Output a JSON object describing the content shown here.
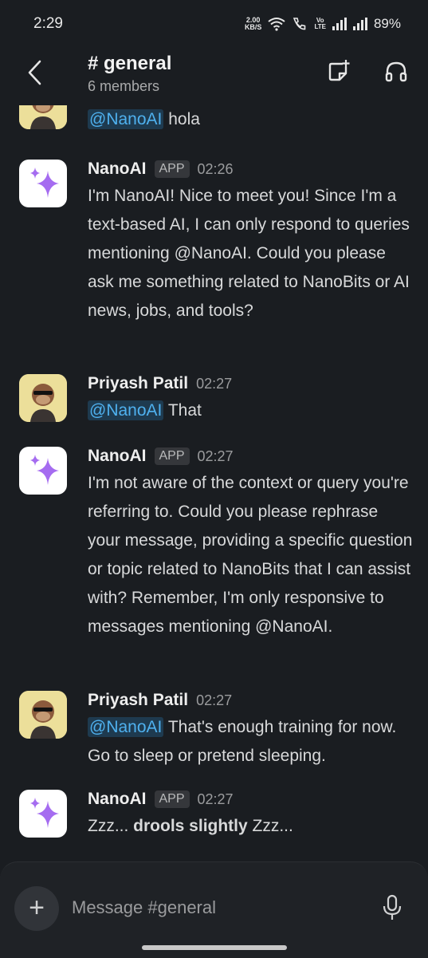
{
  "status_bar": {
    "time": "2:29",
    "net_speed_value": "2.00",
    "net_speed_unit": "KB/S",
    "volte": "Vo",
    "lte": "LTE",
    "battery": "89%"
  },
  "header": {
    "channel": "# general",
    "members": "6 members",
    "icons": [
      "back-icon",
      "canvas-icon",
      "huddle-headphones-icon"
    ]
  },
  "messages": [
    {
      "sender": "",
      "avatar": "ape-avatar",
      "mention": "@NanoAI",
      "text": " hola"
    },
    {
      "sender": "NanoAI",
      "badge": "APP",
      "time": "02:26",
      "avatar": "sparkle-avatar",
      "text": "I'm NanoAI! Nice to meet you! Since I'm a text-based AI, I can only respond to queries mentioning @NanoAI. Could you please ask me something related to NanoBits or AI news, jobs, and tools?"
    },
    {
      "sender": "Priyash Patil",
      "time": "02:27",
      "avatar": "ape-avatar",
      "mention": "@NanoAI",
      "text": " That"
    },
    {
      "sender": "NanoAI",
      "badge": "APP",
      "time": "02:27",
      "avatar": "sparkle-avatar",
      "text": "I'm not aware of the context or query you're referring to. Could you please rephrase your message, providing a specific question or topic related to NanoBits that I can assist with? Remember, I'm only responsive to messages mentioning @NanoAI."
    },
    {
      "sender": "Priyash Patil",
      "time": "02:27",
      "avatar": "ape-avatar",
      "mention": "@NanoAI",
      "text": " That's enough training for now. Go to sleep or pretend sleeping."
    },
    {
      "sender": "NanoAI",
      "badge": "APP",
      "time": "02:27",
      "avatar": "sparkle-avatar",
      "text_pre": "Zzz... ",
      "text_bold": "drools slightly",
      "text_post": " Zzz..."
    }
  ],
  "composer": {
    "plus": "+",
    "placeholder": "Message #general",
    "icons": [
      "plus-icon",
      "mic-icon"
    ]
  },
  "colors": {
    "background": "#1a1d21",
    "mention_text": "#4fb1ef",
    "mention_bg": "#1e3a4f",
    "sparkle": "#a56cf0"
  }
}
